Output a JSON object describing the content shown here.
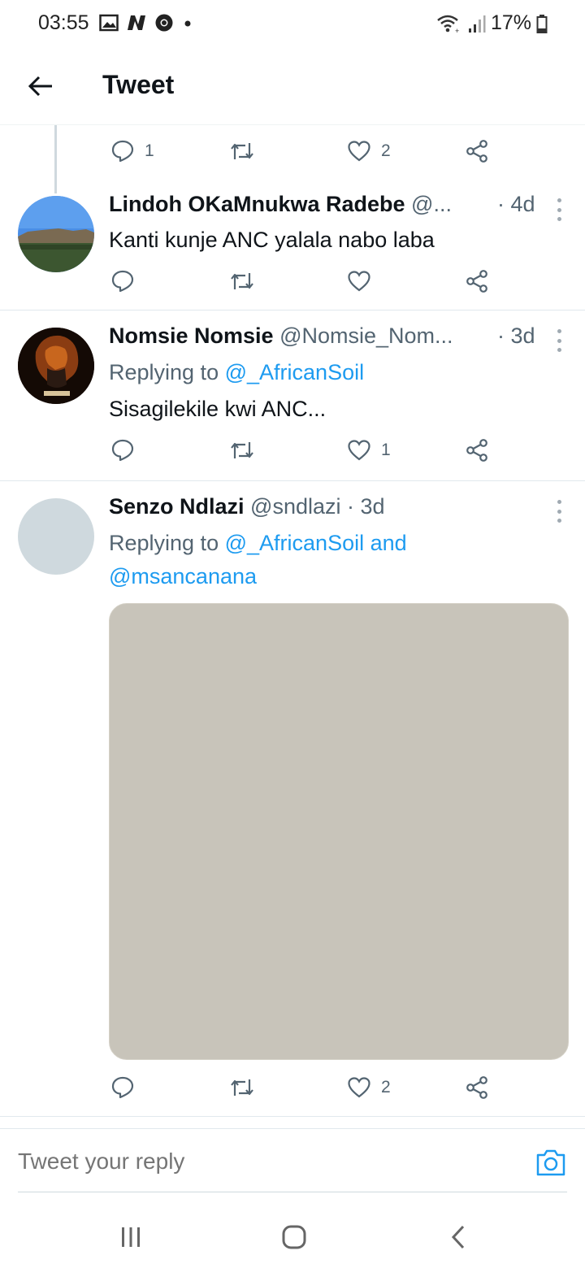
{
  "status_bar": {
    "time": "03:55",
    "battery_percent": "17%",
    "icons": [
      "gallery-icon",
      "n-app-icon",
      "chrome-icon",
      "dot-icon",
      "wifi-icon",
      "signal-icon",
      "battery-icon"
    ]
  },
  "header": {
    "title": "Tweet",
    "back_icon": "arrow-left-icon"
  },
  "top_actions": {
    "reply_count": "1",
    "retweet_count": "",
    "like_count": "2"
  },
  "tweets": [
    {
      "name": "Lindoh OKaMnukwa Radebe",
      "handle": "@...",
      "time": "· 4d",
      "text": "Kanti kunje ANC yalala nabo laba",
      "reply_count": "",
      "retweet_count": "",
      "like_count": ""
    },
    {
      "name": "Nomsie Nomsie",
      "handle": "@Nomsie_Nom...",
      "time": "· 3d",
      "replying_prefix": "Replying to",
      "replying_to": "@_AfricanSoil",
      "text": "Sisagilekile kwi ANC...",
      "reply_count": "",
      "retweet_count": "",
      "like_count": "1"
    },
    {
      "name": "Senzo Ndlazi",
      "handle": "@sndlazi",
      "time": "· 3d",
      "replying_prefix": "Replying to",
      "replying_to": "@_AfricanSoil and",
      "replying_to_2": "@msancanana",
      "reply_count": "",
      "retweet_count": "",
      "like_count": "2"
    }
  ],
  "reply_bar": {
    "placeholder": "Tweet your reply"
  },
  "colors": {
    "accent": "#1d9bf0",
    "secondary_text": "#536471",
    "media_placeholder": "#c8c4ba"
  }
}
